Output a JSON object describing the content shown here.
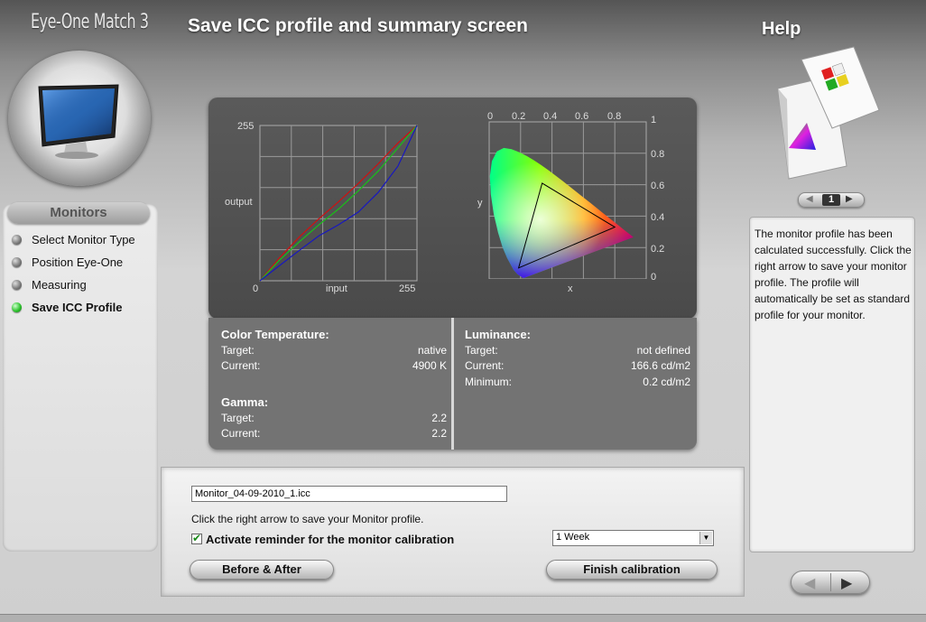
{
  "app": {
    "title": "Eye-One Match 3"
  },
  "header": {
    "page_title": "Save ICC profile and summary screen",
    "help_title": "Help"
  },
  "sidebar": {
    "section": "Monitors",
    "items": [
      {
        "label": "Select Monitor Type",
        "active": false
      },
      {
        "label": "Position Eye-One",
        "active": false
      },
      {
        "label": "Measuring",
        "active": false
      },
      {
        "label": "Save ICC Profile",
        "active": true
      }
    ]
  },
  "curves_chart": {
    "y_max_label": "255",
    "y_label": "output",
    "x_min_label": "0",
    "x_label": "input",
    "x_max_label": "255"
  },
  "gamut_chart": {
    "x_ticks": [
      "0",
      "0.2",
      "0.4",
      "0.6",
      "0.8"
    ],
    "y_ticks": [
      "1",
      "0.8",
      "0.6",
      "0.4",
      "0.2",
      "0"
    ],
    "x_label": "x",
    "y_label": "y"
  },
  "chart_data": [
    {
      "type": "line",
      "xlabel": "input",
      "ylabel": "output",
      "xlim": [
        0,
        255
      ],
      "ylim": [
        0,
        255
      ],
      "grid": true,
      "x": [
        0,
        32,
        64,
        96,
        128,
        160,
        192,
        224,
        255
      ],
      "series": [
        {
          "color": "#d01010",
          "values": [
            0,
            38,
            72,
            102,
            130,
            160,
            192,
            226,
            255
          ]
        },
        {
          "color": "#18c018",
          "values": [
            0,
            34,
            64,
            92,
            118,
            148,
            180,
            218,
            255
          ]
        },
        {
          "color": "#1818c0",
          "values": [
            0,
            25,
            50,
            74,
            92,
            113,
            145,
            188,
            255
          ]
        }
      ]
    },
    {
      "type": "scatter",
      "xlabel": "x",
      "ylabel": "y",
      "xlim": [
        0,
        0.8
      ],
      "ylim": [
        0,
        1
      ],
      "grid": true,
      "gamut_triangle": [
        [
          0.15,
          0.07
        ],
        [
          0.27,
          0.61
        ],
        [
          0.64,
          0.33
        ]
      ]
    }
  ],
  "summary": {
    "color_temp": {
      "heading": "Color Temperature:",
      "target_label": "Target:",
      "target_value": "native",
      "current_label": "Current:",
      "current_value": "4900 K"
    },
    "gamma": {
      "heading": "Gamma:",
      "target_label": "Target:",
      "target_value": "2.2",
      "current_label": "Current:",
      "current_value": "2.2"
    },
    "luminance": {
      "heading": "Luminance:",
      "target_label": "Target:",
      "target_value": "not defined",
      "current_label": "Current:",
      "current_value": "166.6 cd/m2",
      "minimum_label": "Minimum:",
      "minimum_value": "0.2 cd/m2"
    }
  },
  "save": {
    "filename": "Monitor_04-09-2010_1.icc",
    "instruction": "Click the right arrow to save your Monitor profile.",
    "reminder_label": "Activate reminder for the monitor calibration",
    "reminder_checked": true,
    "reminder_interval": "1 Week",
    "before_after_label": "Before & After",
    "finish_label": "Finish calibration"
  },
  "help": {
    "page": "1",
    "text": "The monitor profile has been calculated successfully. Click the right arrow to save your monitor profile. The profile will automatically be set as standard profile for your monitor."
  }
}
